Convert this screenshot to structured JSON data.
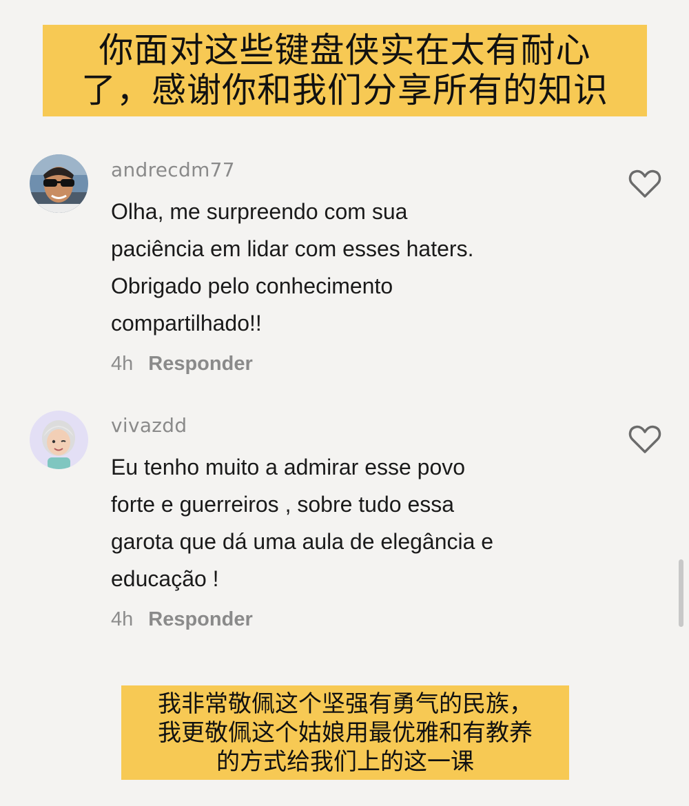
{
  "caption_top": {
    "line1": "你面对这些键盘侠实在太有耐心",
    "line2": "了，感谢你和我们分享所有的知识"
  },
  "comments": [
    {
      "username": "andrecdm77",
      "lines": [
        "Olha, me surpreendo com sua",
        "paciência em lidar com esses haters.",
        "Obrigado pelo conhecimento",
        "compartilhado!!"
      ],
      "time": "4h",
      "reply_label": "Responder"
    },
    {
      "username": "vivazdd",
      "lines": [
        "Eu tenho muito a admirar esse povo",
        "forte e guerreiros , sobre tudo essa",
        "garota que dá uma aula de elegância e",
        "educação !"
      ],
      "time": "4h",
      "reply_label": "Responder"
    }
  ],
  "caption_bottom": {
    "line1": "我非常敬佩这个坚强有勇气的民族，",
    "line2": "我更敬佩这个姑娘用最优雅和有教养",
    "line3": "的方式给我们上的这一课"
  },
  "colors": {
    "caption_bg": "#f7c954",
    "background": "#f4f3f1",
    "muted_text": "#8a8a8a"
  }
}
